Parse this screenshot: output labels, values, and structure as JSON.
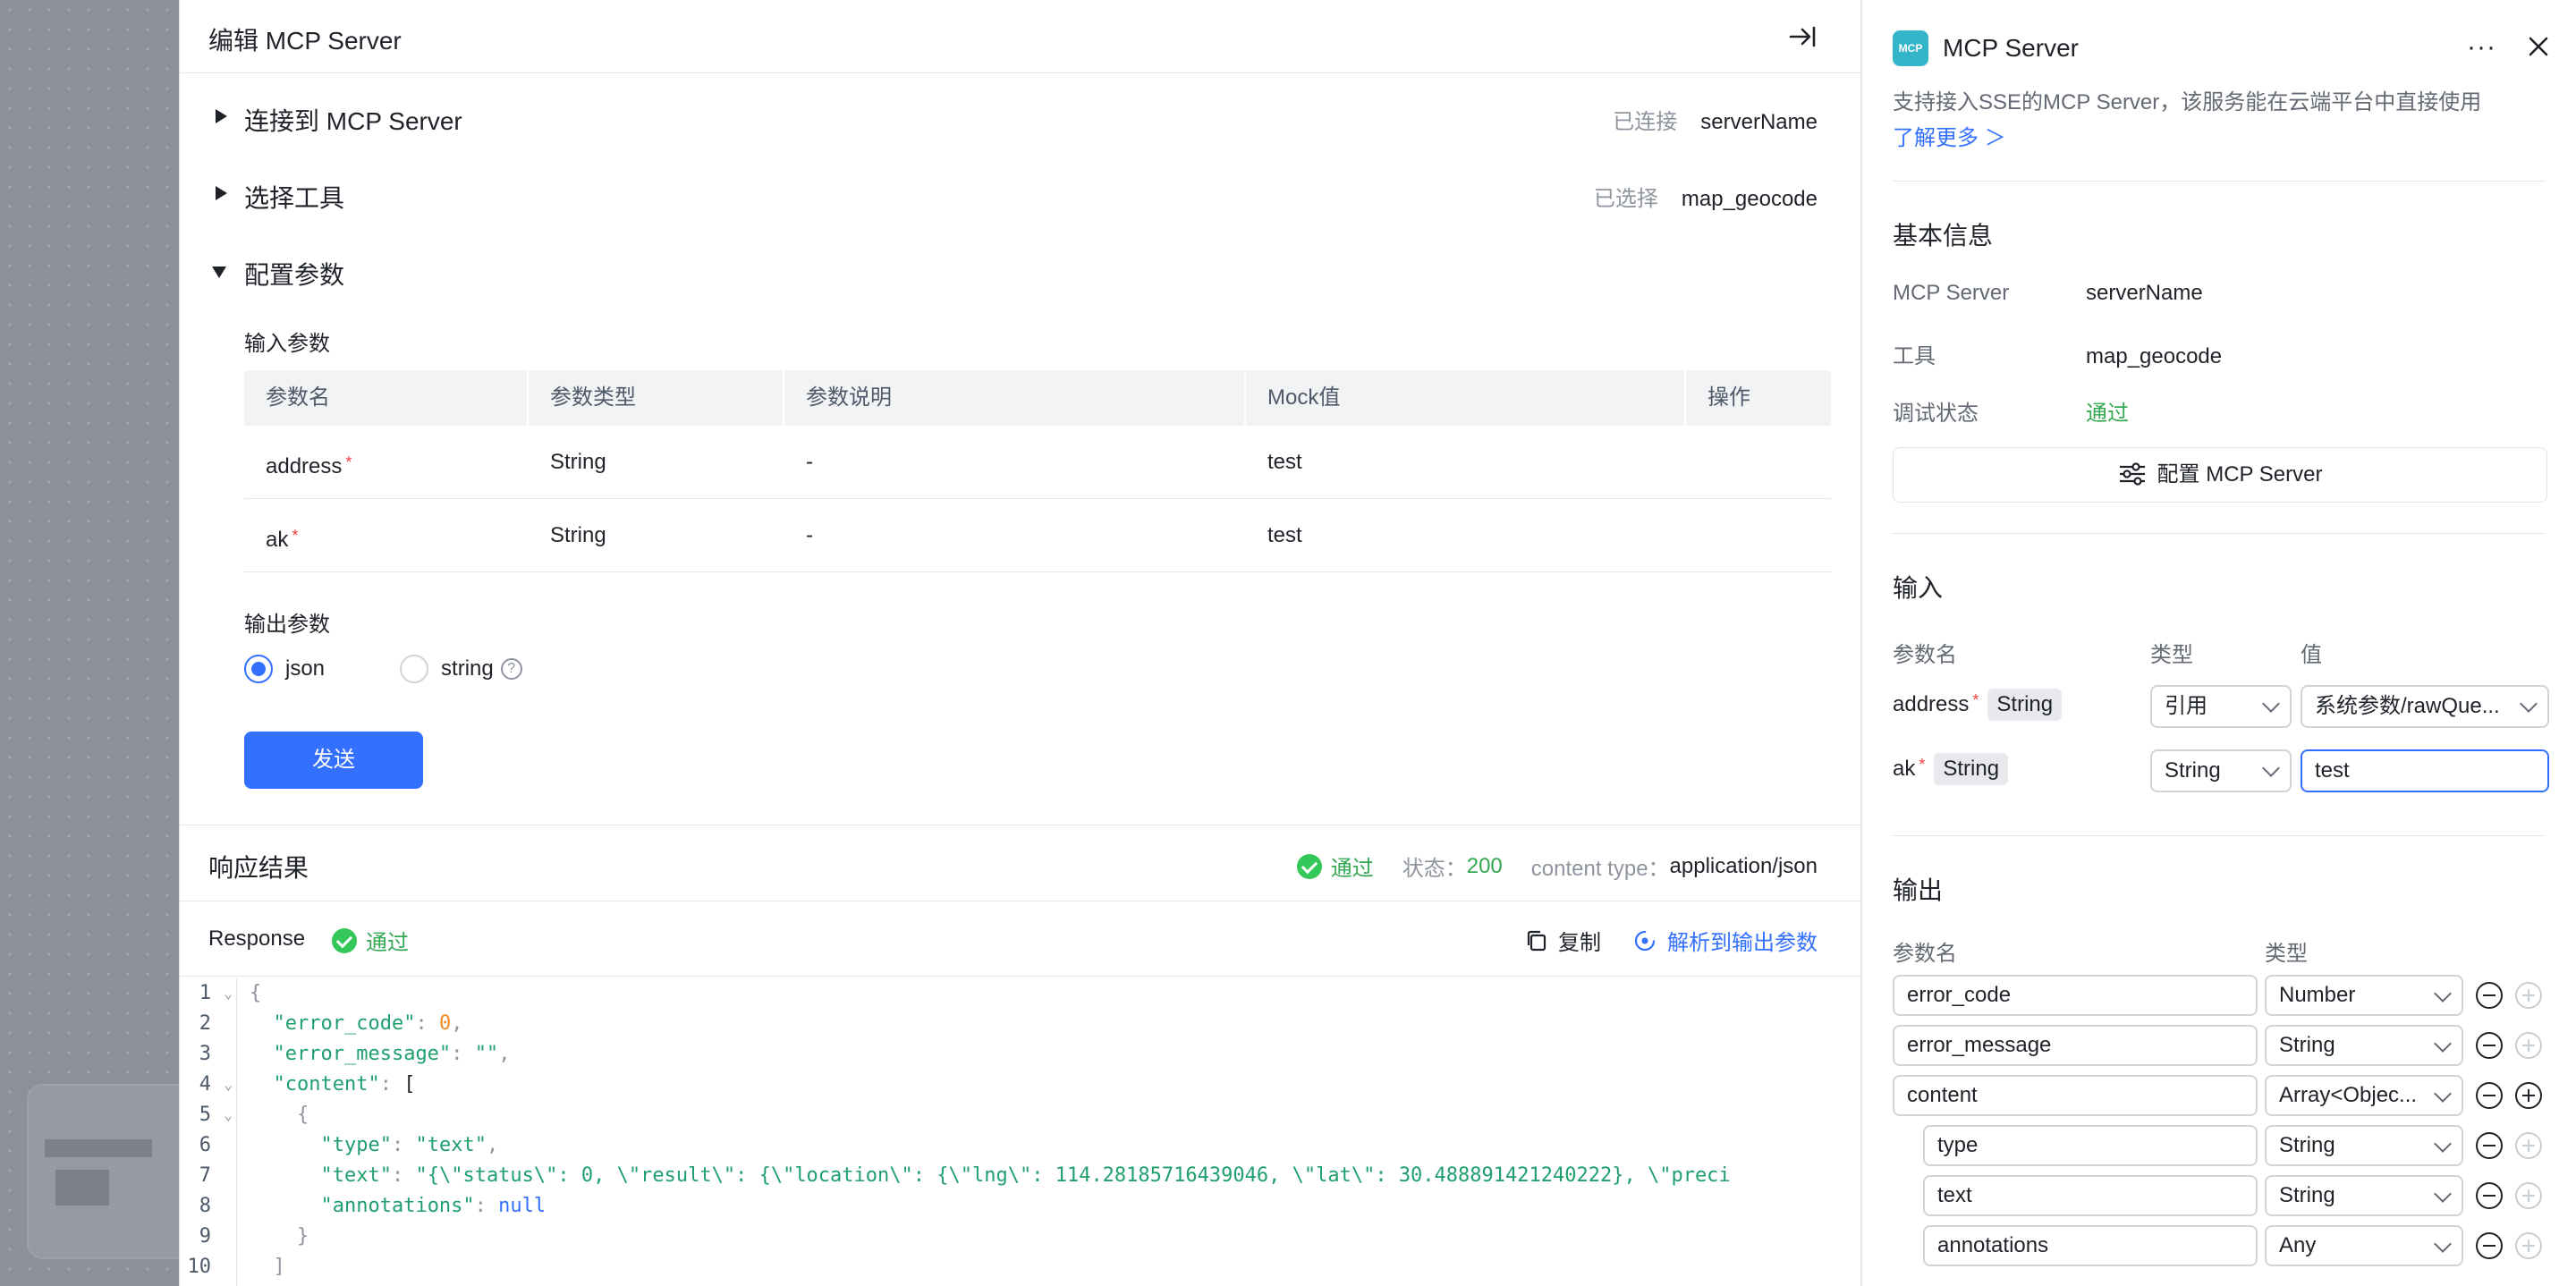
{
  "editor": {
    "title": "编辑 MCP Server",
    "sections": [
      {
        "label": "连接到 MCP Server",
        "meta_key": "已连接",
        "meta_value": "serverName"
      },
      {
        "label": "选择工具",
        "meta_key": "已选择",
        "meta_value": "map_geocode"
      },
      {
        "label": "配置参数"
      }
    ],
    "input_params_label": "输入参数",
    "table": {
      "headers": [
        "参数名",
        "参数类型",
        "参数说明",
        "Mock值",
        "操作"
      ],
      "rows": [
        {
          "name": "address",
          "required": "*",
          "type": "String",
          "desc": "-",
          "mock": "test"
        },
        {
          "name": "ak",
          "required": "*",
          "type": "String",
          "desc": "-",
          "mock": "test"
        }
      ]
    },
    "output_params_label": "输出参数",
    "output_options": [
      {
        "label": "json",
        "selected": true
      },
      {
        "label": "string",
        "selected": false
      }
    ],
    "help_glyph": "?",
    "send_label": "发送"
  },
  "response": {
    "title": "响应结果",
    "status_pass": "通过",
    "status_key": "状态：",
    "status_code": "200",
    "content_type_key": "content type：",
    "content_type": "application/json",
    "bar_label": "Response",
    "bar_pass": "通过",
    "copy_label": "复制",
    "parse_label": "解析到输出参数",
    "line_numbers": [
      "1",
      "2",
      "3",
      "4",
      "5",
      "6",
      "7",
      "8",
      "9",
      "10"
    ],
    "code_lines": [
      "{",
      "  \"error_code\": 0,",
      "  \"error_message\": \"\",",
      "  \"content\": [",
      "    {",
      "      \"type\": \"text\",",
      "      \"text\": \"{\\\"status\\\": 0, \\\"result\\\": {\\\"location\\\": {\\\"lng\\\": 114.28185716439046, \\\"lat\\\": 30.488891421240222}, \\\"preci",
      "      \"annotations\": null",
      "    }",
      "  ]"
    ]
  },
  "panel": {
    "logo_text": "MCP",
    "title": "MCP Server",
    "more_glyph": "···",
    "description": "支持接入SSE的MCP Server，该服务能在云端平台中直接使用",
    "learn_more": "了解更多 ＞",
    "basic_info_title": "基本信息",
    "basic_info": [
      {
        "key": "MCP Server",
        "value": "serverName"
      },
      {
        "key": "工具",
        "value": "map_geocode"
      },
      {
        "key": "调试状态",
        "value": "通过"
      }
    ],
    "config_button": "配置 MCP Server",
    "input_title": "输入",
    "input_headers": [
      "参数名",
      "类型",
      "值"
    ],
    "inputs": [
      {
        "name": "address",
        "required": "*",
        "type_tag": "String",
        "mode": "引用",
        "value": "系统参数/rawQue..."
      },
      {
        "name": "ak",
        "required": "*",
        "type_tag": "String",
        "mode": "String",
        "value": "test"
      }
    ],
    "output_title": "输出",
    "output_headers": [
      "参数名",
      "类型"
    ],
    "outputs": [
      {
        "name": "error_code",
        "type": "Number"
      },
      {
        "name": "error_message",
        "type": "String"
      },
      {
        "name": "content",
        "type": "Array<Objec..."
      },
      {
        "name": "type",
        "type": "String"
      },
      {
        "name": "text",
        "type": "String"
      },
      {
        "name": "annotations",
        "type": "Any"
      }
    ]
  },
  "colors": {
    "accent": "#3370ff",
    "success": "#34c759",
    "required": "#f53f3f",
    "logo": "#35b5c9"
  }
}
